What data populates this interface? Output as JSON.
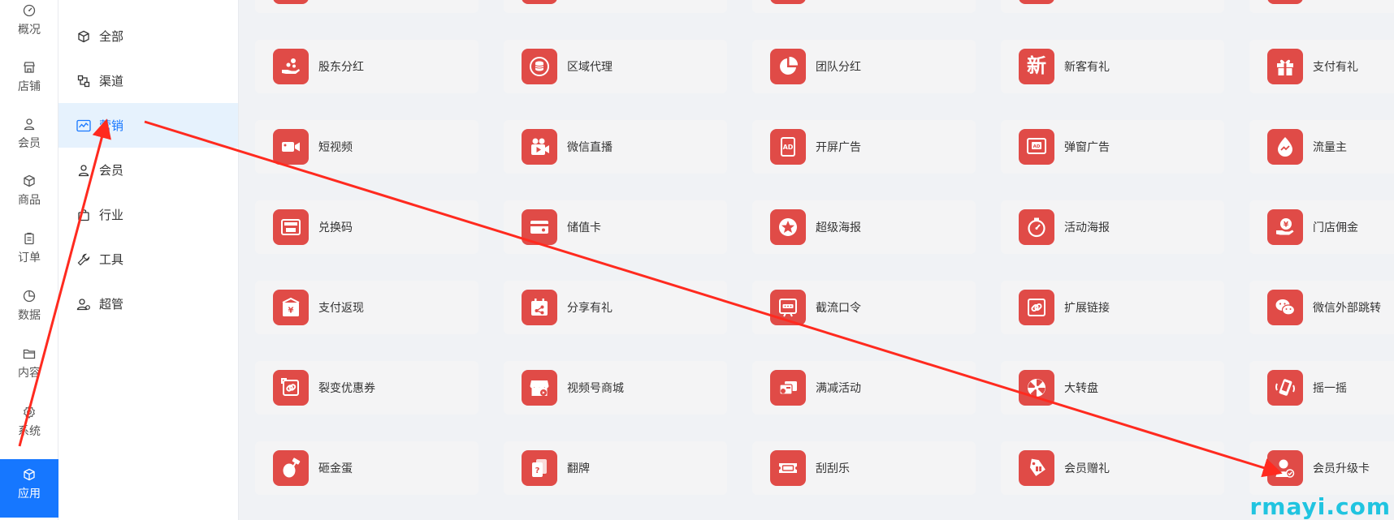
{
  "rail": {
    "items": [
      {
        "label": "概况",
        "icon": "dashboard-icon"
      },
      {
        "label": "店铺",
        "icon": "store-icon"
      },
      {
        "label": "会员",
        "icon": "user-icon"
      },
      {
        "label": "商品",
        "icon": "box-icon"
      },
      {
        "label": "订单",
        "icon": "clipboard-icon"
      },
      {
        "label": "数据",
        "icon": "pie-chart-icon"
      },
      {
        "label": "内容",
        "icon": "folder-icon"
      },
      {
        "label": "系统",
        "icon": "gear-icon"
      },
      {
        "label": "应用",
        "icon": "cube-icon"
      }
    ],
    "active": "应用"
  },
  "submenu": {
    "items": [
      {
        "label": "全部",
        "icon": "cube-icon"
      },
      {
        "label": "渠道",
        "icon": "channel-icon"
      },
      {
        "label": "营销",
        "icon": "marketing-chart-icon"
      },
      {
        "label": "会员",
        "icon": "user-icon"
      },
      {
        "label": "行业",
        "icon": "bag-icon"
      },
      {
        "label": "工具",
        "icon": "wrench-icon"
      },
      {
        "label": "超管",
        "icon": "admin-user-icon"
      }
    ],
    "active": "营销"
  },
  "apps": {
    "top_partial": [
      "",
      "",
      "",
      "",
      ""
    ],
    "rows": [
      [
        {
          "label": "股东分红",
          "icon": "dividend-hand-icon"
        },
        {
          "label": "区域代理",
          "icon": "region-coin-icon"
        },
        {
          "label": "团队分红",
          "icon": "pie-icon"
        },
        {
          "label": "新客有礼",
          "glyph": "新",
          "icon": "new-char-icon"
        },
        {
          "label": "支付有礼",
          "icon": "gift-icon"
        }
      ],
      [
        {
          "label": "短视频",
          "icon": "video-camera-icon"
        },
        {
          "label": "微信直播",
          "icon": "live-camera-icon"
        },
        {
          "label": "开屏广告",
          "icon": "ad-screen-icon"
        },
        {
          "label": "弹窗广告",
          "icon": "popup-ad-icon"
        },
        {
          "label": "流量主",
          "icon": "traffic-drop-icon"
        }
      ],
      [
        {
          "label": "兑换码",
          "icon": "exchange-code-icon"
        },
        {
          "label": "储值卡",
          "icon": "stored-card-icon"
        },
        {
          "label": "超级海报",
          "icon": "star-poster-icon"
        },
        {
          "label": "活动海报",
          "icon": "stopwatch-icon"
        },
        {
          "label": "门店佣金",
          "icon": "commission-icon"
        }
      ],
      [
        {
          "label": "支付返现",
          "icon": "cashback-icon"
        },
        {
          "label": "分享有礼",
          "icon": "share-calendar-icon"
        },
        {
          "label": "截流口令",
          "icon": "password-screen-icon"
        },
        {
          "label": "扩展链接",
          "icon": "link-icon"
        },
        {
          "label": "微信外部跳转",
          "icon": "wechat-icon"
        }
      ],
      [
        {
          "label": "裂变优惠券",
          "icon": "coupon-link-icon"
        },
        {
          "label": "视频号商城",
          "icon": "video-mall-icon"
        },
        {
          "label": "满减活动",
          "icon": "discount-card-icon"
        },
        {
          "label": "大转盘",
          "icon": "wheel-icon"
        },
        {
          "label": "摇一摇",
          "icon": "shake-phone-icon"
        }
      ],
      [
        {
          "label": "砸金蛋",
          "icon": "golden-egg-icon"
        },
        {
          "label": "翻牌",
          "icon": "flip-card-icon"
        },
        {
          "label": "刮刮乐",
          "icon": "scratch-ticket-icon"
        },
        {
          "label": "会员赠礼",
          "icon": "member-gift-tag-icon"
        },
        {
          "label": "会员升级卡",
          "icon": "member-upgrade-icon"
        }
      ]
    ]
  },
  "colors": {
    "accent": "#1677ff",
    "tile": "#e04b47",
    "arrow": "#ff2a1f",
    "watermark": "#20c4e0"
  },
  "watermark": "rmayi.com"
}
